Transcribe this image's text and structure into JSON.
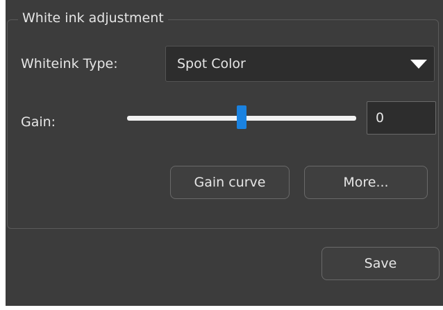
{
  "group": {
    "title": "White ink adjustment"
  },
  "whiteink_type": {
    "label": "Whiteink Type:",
    "value": "Spot Color"
  },
  "gain": {
    "label": "Gain:",
    "value": "0",
    "slider_level": 0.5
  },
  "buttons": {
    "gain_curve": "Gain curve",
    "more": "More...",
    "save": "Save"
  },
  "colors": {
    "panel_bg": "#3c3c3c",
    "accent": "#1a82e0",
    "text": "#e6e6e6"
  }
}
